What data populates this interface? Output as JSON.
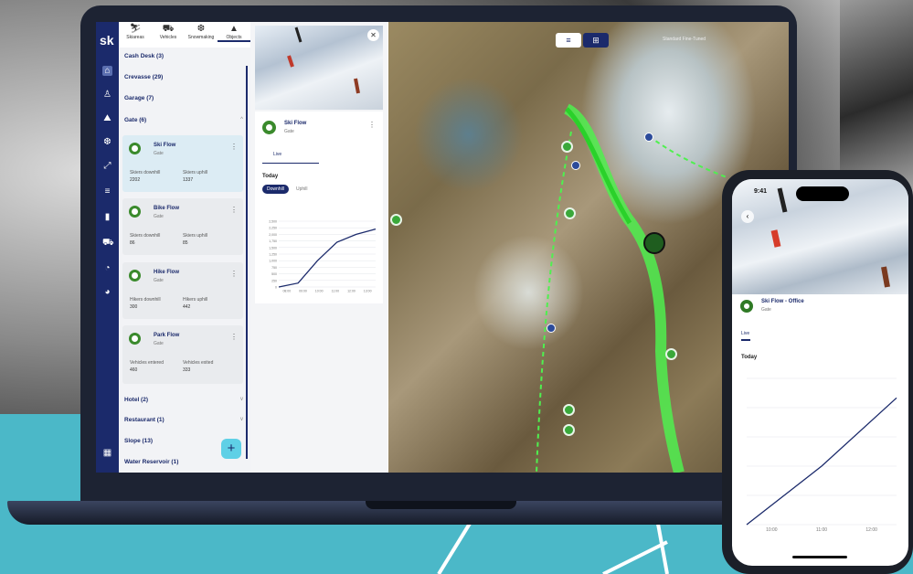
{
  "brand": {
    "logo_text": "sk"
  },
  "colors": {
    "navy": "#1b2a6b",
    "green": "#3aa83a",
    "teal": "#4bb8c8",
    "fab": "#5fd0e6"
  },
  "nav_icons": [
    "home-icon",
    "person-icon",
    "lift-icon",
    "cannon-icon",
    "trail-icon",
    "list-icon",
    "document-icon",
    "cart-icon",
    "chart-icon",
    "weather-icon",
    "grid-icon"
  ],
  "top_tabs": [
    {
      "label": "Skiareas",
      "icon": "skier-icon"
    },
    {
      "label": "Vehicles",
      "icon": "snowcat-icon"
    },
    {
      "label": "Snowmaking",
      "icon": "cannon-icon"
    },
    {
      "label": "Objects",
      "icon": "mountain-icon"
    }
  ],
  "groups": {
    "cash_desk": "Cash Desk (3)",
    "crevasse": "Crevasse (29)",
    "garage": "Garage (7)",
    "gate": "Gate (6)",
    "hotel": "Hotel (2)",
    "restaurant": "Restaurant (1)",
    "slope": "Slope (13)",
    "water_reservoir": "Water Reservoir (1)"
  },
  "gate_items": [
    {
      "title": "Ski Flow",
      "sub": "Gate",
      "k1": "Skiers downhill",
      "v1": "2202",
      "k2": "Skiers uphill",
      "v2": "1337"
    },
    {
      "title": "Bike Flow",
      "sub": "Gate",
      "k1": "Skiers downhill",
      "v1": "86",
      "k2": "Skiers uphill",
      "v2": "85"
    },
    {
      "title": "Hike Flow",
      "sub": "Gate",
      "k1": "Hikers downhill",
      "v1": "300",
      "k2": "Hikers uphill",
      "v2": "442"
    },
    {
      "title": "Park Flow",
      "sub": "Gate",
      "k1": "Vehicles entered",
      "v1": "460",
      "k2": "Vehicles exited",
      "v2": "333"
    }
  ],
  "fab_label": "+",
  "detail": {
    "close_label": "✕",
    "title": "Ski Flow",
    "sub": "Gate",
    "more_label": "⋮",
    "tab_live": "Live",
    "today": "Today",
    "pill_downhill": "Downhill",
    "pill_uphill": "Uphill",
    "y_ticks": [
      "2,500",
      "2,250",
      "2,000",
      "1,750",
      "1,500",
      "1,250",
      "1,000",
      "750",
      "500",
      "250",
      "0"
    ],
    "x_ticks": [
      "08:00",
      "09:00",
      "10:00",
      "11:00",
      "12:00",
      "13:00"
    ]
  },
  "map": {
    "btn_list_icon": "list-icon",
    "btn_layers_icon": "layers-icon",
    "options_label": "Standard    Fine-Tuned"
  },
  "phone": {
    "time": "9:41",
    "back_label": "‹",
    "title": "Ski Flow - Office",
    "sub": "Gate",
    "tab_live": "Live",
    "today": "Today",
    "x_ticks": [
      "10:00",
      "11:00",
      "12:00"
    ]
  },
  "chart_data": [
    {
      "type": "line",
      "title": "",
      "xlabel": "",
      "ylabel": "",
      "x": [
        "08:00",
        "09:00",
        "10:00",
        "11:00",
        "12:00",
        "13:00"
      ],
      "series": [
        {
          "values": [
            0,
            150,
            1000,
            1700,
            2000,
            2200
          ]
        }
      ],
      "ylim": [
        0,
        2500
      ]
    },
    {
      "type": "line",
      "title": "",
      "xlabel": "",
      "ylabel": "",
      "x": [
        "10:00",
        "11:00",
        "12:00"
      ],
      "series": [
        {
          "values": [
            0,
            1200,
            2600
          ]
        }
      ],
      "ylim": [
        0,
        3000
      ]
    }
  ]
}
